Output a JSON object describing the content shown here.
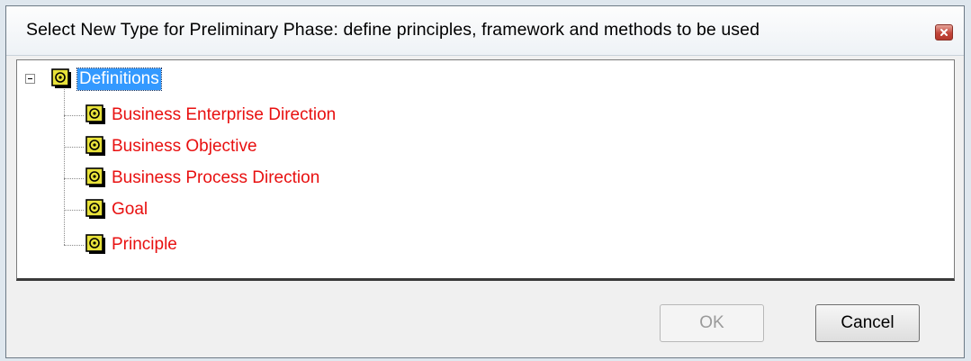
{
  "dialog": {
    "title": "Select New Type for Preliminary Phase: define principles, framework and methods to be used",
    "close_icon": "close-icon"
  },
  "tree": {
    "root": {
      "label": "Definitions",
      "icon": "element-type-icon",
      "expanded": true,
      "selected": true
    },
    "children": [
      {
        "label": "Business Enterprise Direction",
        "icon": "element-type-icon"
      },
      {
        "label": "Business Objective",
        "icon": "element-type-icon"
      },
      {
        "label": "Business Process Direction",
        "icon": "element-type-icon"
      },
      {
        "label": "Goal",
        "icon": "element-type-icon"
      },
      {
        "label": "Principle",
        "icon": "element-type-icon"
      }
    ],
    "colors": {
      "selection": "#3399ff",
      "child_text": "#e81010"
    }
  },
  "buttons": {
    "ok_label": "OK",
    "ok_enabled": false,
    "cancel_label": "Cancel"
  }
}
